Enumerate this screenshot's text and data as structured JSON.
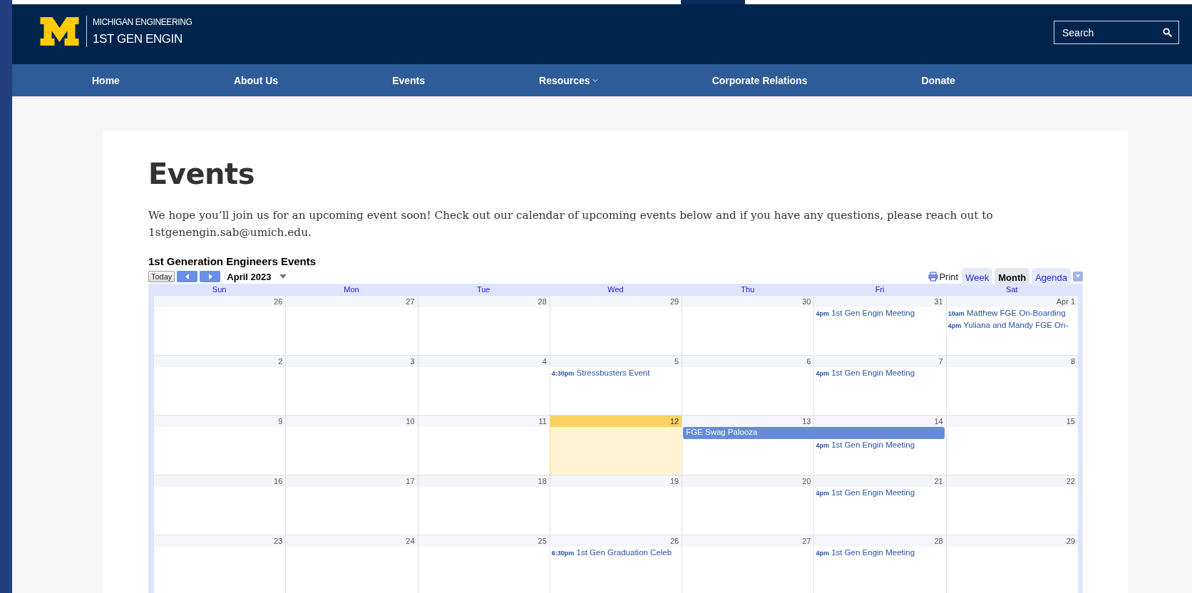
{
  "header": {
    "logo_line_1": "MICHIGAN ENGINEERING",
    "logo_line_2": "1ST GEN ENGIN",
    "search": {
      "placeholder": "Search"
    }
  },
  "nav": [
    {
      "label": "Home",
      "has_menu": false
    },
    {
      "label": "About Us",
      "has_menu": false
    },
    {
      "label": "Events",
      "has_menu": false
    },
    {
      "label": "Resources",
      "has_menu": true
    },
    {
      "label": "Corporate Relations",
      "has_menu": false
    },
    {
      "label": "Donate",
      "has_menu": false
    }
  ],
  "page": {
    "title": "Events",
    "intro": "We hope you’ll join us for an upcoming event soon! Check out our calendar of upcoming events below and if you have any questions, please reach out to 1stgenengin.sab@umich.edu."
  },
  "calendar": {
    "title": "1st Generation Engineers Events",
    "today_button": "Today",
    "month": "April 2023",
    "print": "Print",
    "views": [
      {
        "label": "Week",
        "selected": false
      },
      {
        "label": "Month",
        "selected": true
      },
      {
        "label": "Agenda",
        "selected": false
      }
    ],
    "weekdays": [
      "Sun",
      "Mon",
      "Tue",
      "Wed",
      "Thu",
      "Fri",
      "Sat"
    ],
    "weeks": [
      [
        {
          "day": "26",
          "today": false
        },
        {
          "day": "27",
          "today": false
        },
        {
          "day": "28",
          "today": false
        },
        {
          "day": "29",
          "today": false
        },
        {
          "day": "30",
          "today": false
        },
        {
          "day": "31",
          "today": false,
          "events": [
            {
              "kind": "timed",
              "time": "4pm",
              "title": "1st Gen Engin Meeting"
            }
          ]
        },
        {
          "day": "Apr 1",
          "today": false,
          "events": [
            {
              "kind": "timed",
              "time": "10am",
              "title": "Matthew FGE On-Boarding"
            },
            {
              "kind": "timed",
              "time": "4pm",
              "title": "Yuliana and Mandy FGE On-"
            }
          ]
        }
      ],
      [
        {
          "day": "2",
          "today": false
        },
        {
          "day": "3",
          "today": false
        },
        {
          "day": "4",
          "today": false
        },
        {
          "day": "5",
          "today": false,
          "events": [
            {
              "kind": "timed",
              "time": "4:30pm",
              "title": "Stressbusters Event"
            }
          ]
        },
        {
          "day": "6",
          "today": false
        },
        {
          "day": "7",
          "today": false,
          "events": [
            {
              "kind": "timed",
              "time": "4pm",
              "title": "1st Gen Engin Meeting"
            }
          ]
        },
        {
          "day": "8",
          "today": false
        }
      ],
      [
        {
          "day": "9",
          "today": false
        },
        {
          "day": "10",
          "today": false
        },
        {
          "day": "11",
          "today": false
        },
        {
          "day": "12",
          "today": true
        },
        {
          "day": "13",
          "today": false,
          "events": [
            {
              "kind": "allday",
              "title": "FGE Swag Palooza"
            }
          ]
        },
        {
          "day": "14",
          "today": false,
          "events": [
            {
              "kind": "allday_continued"
            },
            {
              "kind": "timed",
              "time": "4pm",
              "title": "1st Gen Engin Meeting"
            }
          ]
        },
        {
          "day": "15",
          "today": false
        }
      ],
      [
        {
          "day": "16",
          "today": false
        },
        {
          "day": "17",
          "today": false
        },
        {
          "day": "18",
          "today": false
        },
        {
          "day": "19",
          "today": false
        },
        {
          "day": "20",
          "today": false
        },
        {
          "day": "21",
          "today": false,
          "events": [
            {
              "kind": "timed",
              "time": "4pm",
              "title": "1st Gen Engin Meeting"
            }
          ]
        },
        {
          "day": "22",
          "today": false
        }
      ],
      [
        {
          "day": "23",
          "today": false
        },
        {
          "day": "24",
          "today": false
        },
        {
          "day": "25",
          "today": false
        },
        {
          "day": "26",
          "today": false,
          "events": [
            {
              "kind": "timed",
              "time": "6:30pm",
              "title": "1st Gen Graduation Celeb"
            }
          ]
        },
        {
          "day": "27",
          "today": false
        },
        {
          "day": "28",
          "today": false,
          "events": [
            {
              "kind": "timed",
              "time": "4pm",
              "title": "1st Gen Engin Meeting"
            }
          ]
        },
        {
          "day": "29",
          "today": false
        }
      ]
    ]
  }
}
